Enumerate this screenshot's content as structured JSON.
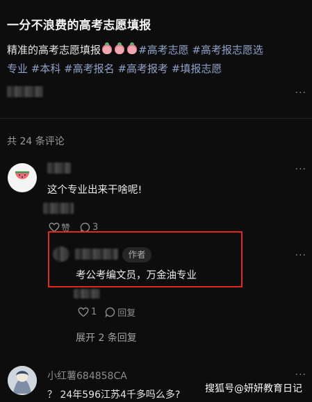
{
  "post": {
    "title": "一分不浪费的高考志愿填报",
    "desc_prefix": "精准的高考志愿填报",
    "tags_line1": "#高考志愿 #高考报志愿选",
    "tags_line2": "专业 #本科 #高考报名 #高考报考 #填报志愿",
    "more_icon": "···"
  },
  "comments": {
    "count_label": "共 24 条评论",
    "first": {
      "text": "这个专业出来干啥呢!",
      "like_label": "赞",
      "reply_count": "3",
      "more_icon": "···"
    },
    "reply": {
      "badge": "作者",
      "text": "考公考编文员，万金油专业",
      "like_count": "1",
      "reply_label": "回复",
      "more_icon": "···"
    },
    "expand_label": "展开 2 条回复",
    "second": {
      "username": "小红薯684858CA",
      "text": "？ 24年596江苏4千多吗么多?",
      "more_icon": "···"
    }
  },
  "watermark": "搜狐号@妍妍教育日记",
  "colors": {
    "tag": "#8ea2c7",
    "highlight_box": "#e0281f",
    "background": "#0d0d0d"
  }
}
